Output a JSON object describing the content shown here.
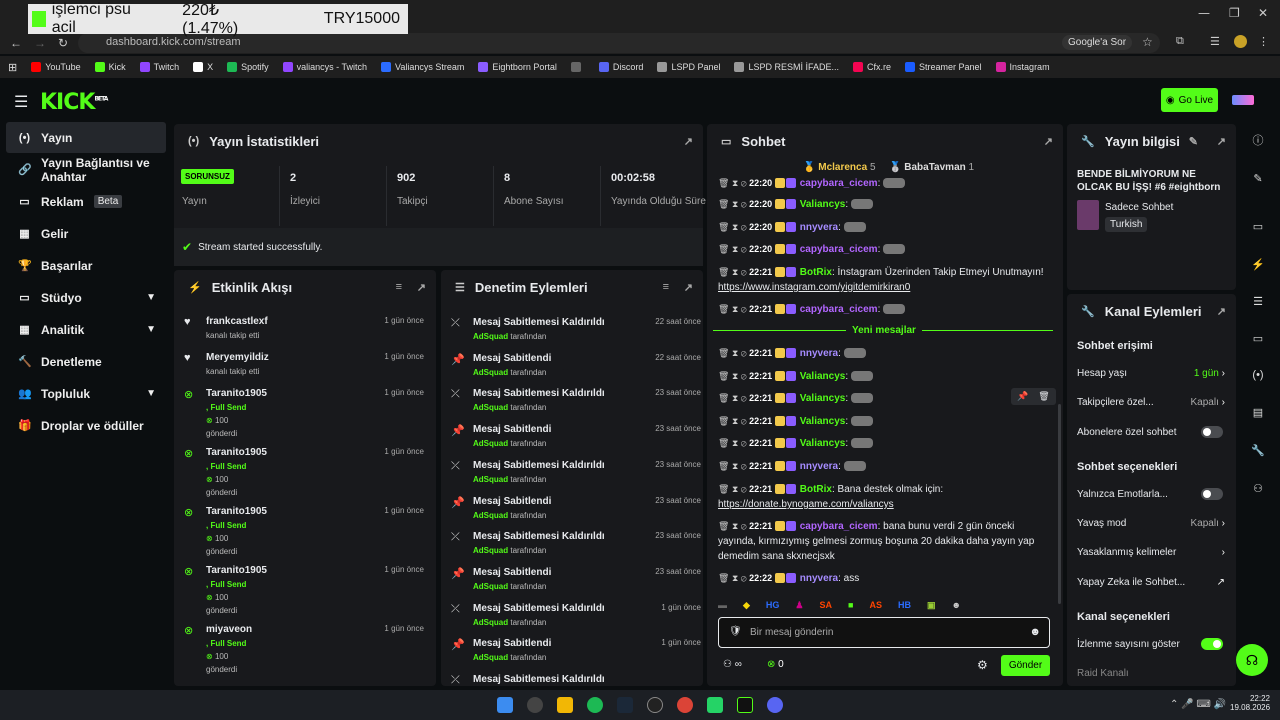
{
  "overlay": {
    "name": "işlemci psu acil",
    "price": "220₺ (1.47%)",
    "target": "TRY15000"
  },
  "browser": {
    "url": "dashboard.kick.com/stream",
    "google": "Google'a Sor",
    "bookmarks": [
      {
        "label": "YouTube",
        "color": "#ff0000"
      },
      {
        "label": "Kick",
        "color": "#53fc18"
      },
      {
        "label": "Twitch",
        "color": "#9146ff"
      },
      {
        "label": "X",
        "color": "#ffffff"
      },
      {
        "label": "Spotify",
        "color": "#1db954"
      },
      {
        "label": "valiancys - Twitch",
        "color": "#9146ff"
      },
      {
        "label": "Valiancys Stream",
        "color": "#2b6cff"
      },
      {
        "label": "Eightborn Portal",
        "color": "#8a5cff"
      },
      {
        "label": "",
        "color": "#666666"
      },
      {
        "label": "Discord",
        "color": "#5865f2"
      },
      {
        "label": "LSPD Panel",
        "color": "#999999"
      },
      {
        "label": "LSPD  RESMİ İFADE...",
        "color": "#999999"
      },
      {
        "label": "Cfx.re",
        "color": "#f40552"
      },
      {
        "label": "Streamer Panel",
        "color": "#1a5cff"
      },
      {
        "label": "Instagram",
        "color": "#d6249f"
      }
    ]
  },
  "app": {
    "logo": "KICK",
    "beta": "BETA",
    "golive": "Go Live"
  },
  "sidebar": [
    {
      "label": "Yayın",
      "icon": "(•)",
      "active": true
    },
    {
      "label": "Yayın Bağlantısı ve Anahtar",
      "icon": "🔗"
    },
    {
      "label": "Reklam",
      "icon": "▭",
      "beta": "Beta"
    },
    {
      "label": "Gelir",
      "icon": "▦"
    },
    {
      "label": "Başarılar",
      "icon": "🏆"
    },
    {
      "label": "Stüdyo",
      "icon": "▭",
      "chev": true
    },
    {
      "label": "Analitik",
      "icon": "▦",
      "chev": true
    },
    {
      "label": "Denetleme",
      "icon": "🔨"
    },
    {
      "label": "Topluluk",
      "icon": "👥",
      "chev": true
    },
    {
      "label": "Droplar ve ödüller",
      "icon": "🎁"
    }
  ],
  "stats": {
    "title": "Yayın İstatistikleri",
    "status": "SORUNSUZ",
    "status_label": "Yayın",
    "success": "Stream started successfully.",
    "items": [
      {
        "value": "2",
        "label": "İzleyici"
      },
      {
        "value": "902",
        "label": "Takipçi"
      },
      {
        "value": "8",
        "label": "Abone Sayısı"
      },
      {
        "value": "00:02:58",
        "label": "Yayında Olduğu Süre"
      }
    ]
  },
  "activity": {
    "title": "Etkinlik Akışı",
    "items": [
      {
        "name": "frankcastlexf",
        "sub": "kanalı takip etti",
        "time": "1 gün önce",
        "type": "follow"
      },
      {
        "name": "Meryemyildiz",
        "sub": "kanalı takip etti",
        "time": "1 gün önce",
        "type": "follow"
      },
      {
        "name": "Taranito1905",
        "sub": ", Full Send",
        "amount": "100",
        "sent": "gönderdi",
        "time": "1 gün önce",
        "type": "send"
      },
      {
        "name": "Taranito1905",
        "sub": ", Full Send",
        "amount": "100",
        "sent": "gönderdi",
        "time": "1 gün önce",
        "type": "send"
      },
      {
        "name": "Taranito1905",
        "sub": ", Full Send",
        "amount": "100",
        "sent": "gönderdi",
        "time": "1 gün önce",
        "type": "send"
      },
      {
        "name": "Taranito1905",
        "sub": ", Full Send",
        "amount": "100",
        "sent": "gönderdi",
        "time": "1 gün önce",
        "type": "send"
      },
      {
        "name": "miyaveon",
        "sub": ", Full Send",
        "amount": "100",
        "sent": "gönderdi",
        "time": "1 gün önce",
        "type": "send"
      }
    ]
  },
  "moderation": {
    "title": "Denetim Eylemleri",
    "by": "tarafından",
    "items": [
      {
        "action": "Mesaj Sabitlemesi Kaldırıldı",
        "who": "AdSquad",
        "time": "22 saat önce"
      },
      {
        "action": "Mesaj Sabitlendi",
        "who": "AdSquad",
        "time": "22 saat önce"
      },
      {
        "action": "Mesaj Sabitlemesi Kaldırıldı",
        "who": "AdSquad",
        "time": "23 saat önce"
      },
      {
        "action": "Mesaj Sabitlendi",
        "who": "AdSquad",
        "time": "23 saat önce"
      },
      {
        "action": "Mesaj Sabitlemesi Kaldırıldı",
        "who": "AdSquad",
        "time": "23 saat önce"
      },
      {
        "action": "Mesaj Sabitlendi",
        "who": "AdSquad",
        "time": "23 saat önce"
      },
      {
        "action": "Mesaj Sabitlemesi Kaldırıldı",
        "who": "AdSquad",
        "time": "23 saat önce"
      },
      {
        "action": "Mesaj Sabitlendi",
        "who": "AdSquad",
        "time": "23 saat önce"
      },
      {
        "action": "Mesaj Sabitlemesi Kaldırıldı",
        "who": "AdSquad",
        "time": "1 gün önce"
      },
      {
        "action": "Mesaj Sabitlendi",
        "who": "AdSquad",
        "time": "1 gün önce"
      },
      {
        "action": "Mesaj Sabitlemesi Kaldırıldı",
        "who": "",
        "time": ""
      }
    ]
  },
  "chat": {
    "title": "Sohbet",
    "top1": "Mclarenca",
    "top1n": "5",
    "top2": "BabaTavman",
    "top2n": "1",
    "new_label": "Yeni mesajlar",
    "placeholder": "Bir mesaj gönderin",
    "send": "Gönder",
    "points": "0",
    "messages": [
      {
        "time": "22:20",
        "user": "capybara_cicem",
        "color": "#b266ff",
        "text": ""
      },
      {
        "time": "22:20",
        "user": "Valiancys",
        "color": "#53fc18",
        "text": ""
      },
      {
        "time": "22:20",
        "user": "nnyvera",
        "color": "#a68cff",
        "text": ""
      },
      {
        "time": "22:20",
        "user": "capybara_cicem",
        "color": "#b266ff",
        "text": ""
      },
      {
        "time": "22:21",
        "user": "BotRix",
        "color": "#53fc18",
        "text": "İnstagram Üzerinden Takip Etmeyi Unutmayın!",
        "link": "https://www.instagram.com/yigitdemirkiran0"
      },
      {
        "time": "22:21",
        "user": "capybara_cicem",
        "color": "#b266ff",
        "text": ""
      },
      {
        "time": "22:21",
        "user": "nnyvera",
        "color": "#a68cff",
        "text": ""
      },
      {
        "time": "22:21",
        "user": "Valiancys",
        "color": "#53fc18",
        "text": ""
      },
      {
        "time": "22:21",
        "user": "Valiancys",
        "color": "#53fc18",
        "text": ""
      },
      {
        "time": "22:21",
        "user": "Valiancys",
        "color": "#53fc18",
        "text": ""
      },
      {
        "time": "22:21",
        "user": "Valiancys",
        "color": "#53fc18",
        "text": ""
      },
      {
        "time": "22:21",
        "user": "nnyvera",
        "color": "#a68cff",
        "text": ""
      },
      {
        "time": "22:21",
        "user": "BotRix",
        "color": "#53fc18",
        "text": "Bana destek olmak için:",
        "link": "https://donate.bynogame.com/valiancys"
      },
      {
        "time": "22:21",
        "user": "capybara_cicem",
        "color": "#b266ff",
        "text": "bana bunu verdi 2 gün önceki yayında, kırmızıymış gelmesi zormuş boşuna 20 dakika daha yayın yap demedim sana skxnecjsxk"
      },
      {
        "time": "22:22",
        "user": "nnyvera",
        "color": "#a68cff",
        "text": "ass"
      }
    ]
  },
  "info": {
    "title": "Yayın bilgisi",
    "stream_title": "BENDE BİLMİYORUM NE OLCAK BU İŞŞ! #6 #eightborn",
    "category": "Sadece Sohbet",
    "language": "Turkish"
  },
  "channel": {
    "title": "Kanal Eylemleri",
    "chat_access": "Sohbet erişimi",
    "account_age": "Hesap yaşı",
    "account_age_val": "1 gün",
    "followers_only": "Takipçilere özel...",
    "followers_only_val": "Kapalı",
    "subs_only": "Abonelere özel sohbet",
    "chat_options": "Sohbet seçenekleri",
    "emotes_only": "Yalnızca Emotlarla...",
    "slow_mode": "Yavaş mod",
    "slow_mode_val": "Kapalı",
    "banned_words": "Yasaklanmış kelimeler",
    "ai": "Yapay Zeka ile Sohbet...",
    "channel_options": "Kanal seçenekleri",
    "show_views": "İzlenme sayısını göster",
    "raid": "Raid Kanalı"
  },
  "system": {
    "time": "22:22",
    "date": "19.08.2026"
  },
  "icons": {
    "menu": "hamburger-icon",
    "bolt": "lightning-icon",
    "list": "list-icon",
    "chat": "chat-icon",
    "wrench": "wrench-icon",
    "close": "close-icon"
  },
  "colors": {
    "accent": "#53fc18",
    "panel": "#18191c",
    "bg": "#0b0e10"
  }
}
